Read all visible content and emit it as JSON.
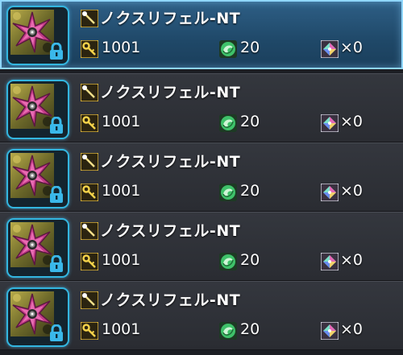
{
  "items": [
    {
      "name": "ノクスリフェル-NT",
      "key_value": "1001",
      "leaf_value": "20",
      "gem_value": "×0",
      "selected": true,
      "locked": true,
      "icons": {
        "type": "rod-icon",
        "key": "key-icon",
        "leaf": "green-swirl-icon",
        "gem": "crystal-icon",
        "lock": "lock-icon"
      }
    },
    {
      "name": "ノクスリフェル-NT",
      "key_value": "1001",
      "leaf_value": "20",
      "gem_value": "×0",
      "selected": false,
      "locked": true,
      "icons": {
        "type": "rod-icon",
        "key": "key-icon",
        "leaf": "green-swirl-icon",
        "gem": "crystal-icon",
        "lock": "lock-icon"
      }
    },
    {
      "name": "ノクスリフェル-NT",
      "key_value": "1001",
      "leaf_value": "20",
      "gem_value": "×0",
      "selected": false,
      "locked": true,
      "icons": {
        "type": "rod-icon",
        "key": "key-icon",
        "leaf": "green-swirl-icon",
        "gem": "crystal-icon",
        "lock": "lock-icon"
      }
    },
    {
      "name": "ノクスリフェル-NT",
      "key_value": "1001",
      "leaf_value": "20",
      "gem_value": "×0",
      "selected": false,
      "locked": true,
      "icons": {
        "type": "rod-icon",
        "key": "key-icon",
        "leaf": "green-swirl-icon",
        "gem": "crystal-icon",
        "lock": "lock-icon"
      }
    },
    {
      "name": "ノクスリフェル-NT",
      "key_value": "1001",
      "leaf_value": "20",
      "gem_value": "×0",
      "selected": false,
      "locked": true,
      "icons": {
        "type": "rod-icon",
        "key": "key-icon",
        "leaf": "green-swirl-icon",
        "gem": "crystal-icon",
        "lock": "lock-icon"
      }
    }
  ],
  "colors": {
    "selected_border": "#8fd6ff",
    "thumb_border": "#33b6e0",
    "lock_blue": "#3ab8ea",
    "leaf_green": "#3fc26a",
    "key_gold": "#e8c23a"
  }
}
